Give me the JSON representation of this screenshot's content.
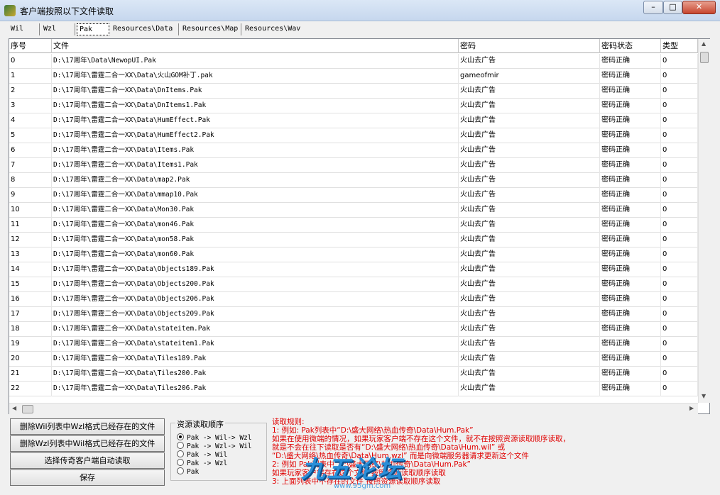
{
  "window": {
    "title": "客户端按照以下文件读取",
    "controls": {
      "minimize": "–",
      "maximize": "□",
      "close": "✕"
    }
  },
  "tabs": [
    {
      "label": "Wil"
    },
    {
      "label": "Wzl"
    },
    {
      "label": "Pak"
    },
    {
      "label": "Resources\\Data"
    },
    {
      "label": "Resources\\Map"
    },
    {
      "label": "Resources\\Wav"
    }
  ],
  "active_tab": "Pak",
  "table": {
    "columns": [
      "序号",
      "文件",
      "密码",
      "密码状态",
      "类型"
    ],
    "rows": [
      [
        "0",
        "D:\\17周年\\Data\\NewopUI.Pak",
        "火山去广告",
        "密码正确",
        "0"
      ],
      [
        "1",
        "D:\\17周年\\雷霆二合一XX\\Data\\火山GOM补丁.pak",
        "gameofmir",
        "密码正确",
        "0"
      ],
      [
        "2",
        "D:\\17周年\\雷霆二合一XX\\Data\\DnItems.Pak",
        "火山去广告",
        "密码正确",
        "0"
      ],
      [
        "3",
        "D:\\17周年\\雷霆二合一XX\\Data\\DnItems1.Pak",
        "火山去广告",
        "密码正确",
        "0"
      ],
      [
        "4",
        "D:\\17周年\\雷霆二合一XX\\Data\\HumEffect.Pak",
        "火山去广告",
        "密码正确",
        "0"
      ],
      [
        "5",
        "D:\\17周年\\雷霆二合一XX\\Data\\HumEffect2.Pak",
        "火山去广告",
        "密码正确",
        "0"
      ],
      [
        "6",
        "D:\\17周年\\雷霆二合一XX\\Data\\Items.Pak",
        "火山去广告",
        "密码正确",
        "0"
      ],
      [
        "7",
        "D:\\17周年\\雷霆二合一XX\\Data\\Items1.Pak",
        "火山去广告",
        "密码正确",
        "0"
      ],
      [
        "8",
        "D:\\17周年\\雷霆二合一XX\\Data\\map2.Pak",
        "火山去广告",
        "密码正确",
        "0"
      ],
      [
        "9",
        "D:\\17周年\\雷霆二合一XX\\Data\\mmap10.Pak",
        "火山去广告",
        "密码正确",
        "0"
      ],
      [
        "10",
        "D:\\17周年\\雷霆二合一XX\\Data\\Mon30.Pak",
        "火山去广告",
        "密码正确",
        "0"
      ],
      [
        "11",
        "D:\\17周年\\雷霆二合一XX\\Data\\mon46.Pak",
        "火山去广告",
        "密码正确",
        "0"
      ],
      [
        "12",
        "D:\\17周年\\雷霆二合一XX\\Data\\mon58.Pak",
        "火山去广告",
        "密码正确",
        "0"
      ],
      [
        "13",
        "D:\\17周年\\雷霆二合一XX\\Data\\mon60.Pak",
        "火山去广告",
        "密码正确",
        "0"
      ],
      [
        "14",
        "D:\\17周年\\雷霆二合一XX\\Data\\Objects189.Pak",
        "火山去广告",
        "密码正确",
        "0"
      ],
      [
        "15",
        "D:\\17周年\\雷霆二合一XX\\Data\\Objects200.Pak",
        "火山去广告",
        "密码正确",
        "0"
      ],
      [
        "16",
        "D:\\17周年\\雷霆二合一XX\\Data\\Objects206.Pak",
        "火山去广告",
        "密码正确",
        "0"
      ],
      [
        "17",
        "D:\\17周年\\雷霆二合一XX\\Data\\Objects209.Pak",
        "火山去广告",
        "密码正确",
        "0"
      ],
      [
        "18",
        "D:\\17周年\\雷霆二合一XX\\Data\\stateitem.Pak",
        "火山去广告",
        "密码正确",
        "0"
      ],
      [
        "19",
        "D:\\17周年\\雷霆二合一XX\\Data\\stateitem1.Pak",
        "火山去广告",
        "密码正确",
        "0"
      ],
      [
        "20",
        "D:\\17周年\\雷霆二合一XX\\Data\\Tiles189.Pak",
        "火山去广告",
        "密码正确",
        "0"
      ],
      [
        "21",
        "D:\\17周年\\雷霆二合一XX\\Data\\Tiles200.Pak",
        "火山去广告",
        "密码正确",
        "0"
      ],
      [
        "22",
        "D:\\17周年\\雷霆二合一XX\\Data\\Tiles206.Pak",
        "火山去广告",
        "密码正确",
        "0"
      ]
    ]
  },
  "actions": [
    "删除Wil列表中Wzl格式已经存在的文件",
    "删除Wzl列表中Wil格式已经存在的文件",
    "选择传奇客户端自动读取",
    "保存"
  ],
  "read_order": {
    "title": "资源读取顺序",
    "options": [
      "Pak -> Wil-> Wzl",
      "Pak -> Wzl-> Wil",
      "Pak -> Wil",
      "Pak -> Wzl",
      "Pak"
    ],
    "selected": 0
  },
  "rules": [
    "读取规则:",
    "1: 例如: Pak列表中“D:\\盛大网络\\热血传奇\\Data\\Hum.Pak”",
    "     如果在使用微端的情况，如果玩家客户端不存在这个文件，就不在按照资源读取顺序读取，",
    "     就是不会在往下读取是否有“D:\\盛大网络\\热血传奇\\Data\\Hum.wil” 或",
    "     “D:\\盛大网络\\热血传奇\\Data\\Hum.wzl” 而是向微端服务器请求更新这个文件",
    "2: 例如 Pak列表中“D:\\盛大网络\\热血传奇\\Data\\Hum.Pak”",
    "     如果玩家客户端存在这个文件 按照资源读取顺序读取",
    "3: 上面列表中不存在的文件 按照资源读取顺序读取"
  ],
  "watermark": {
    "logo": "九五论坛",
    "url": "www.95gm.com"
  }
}
